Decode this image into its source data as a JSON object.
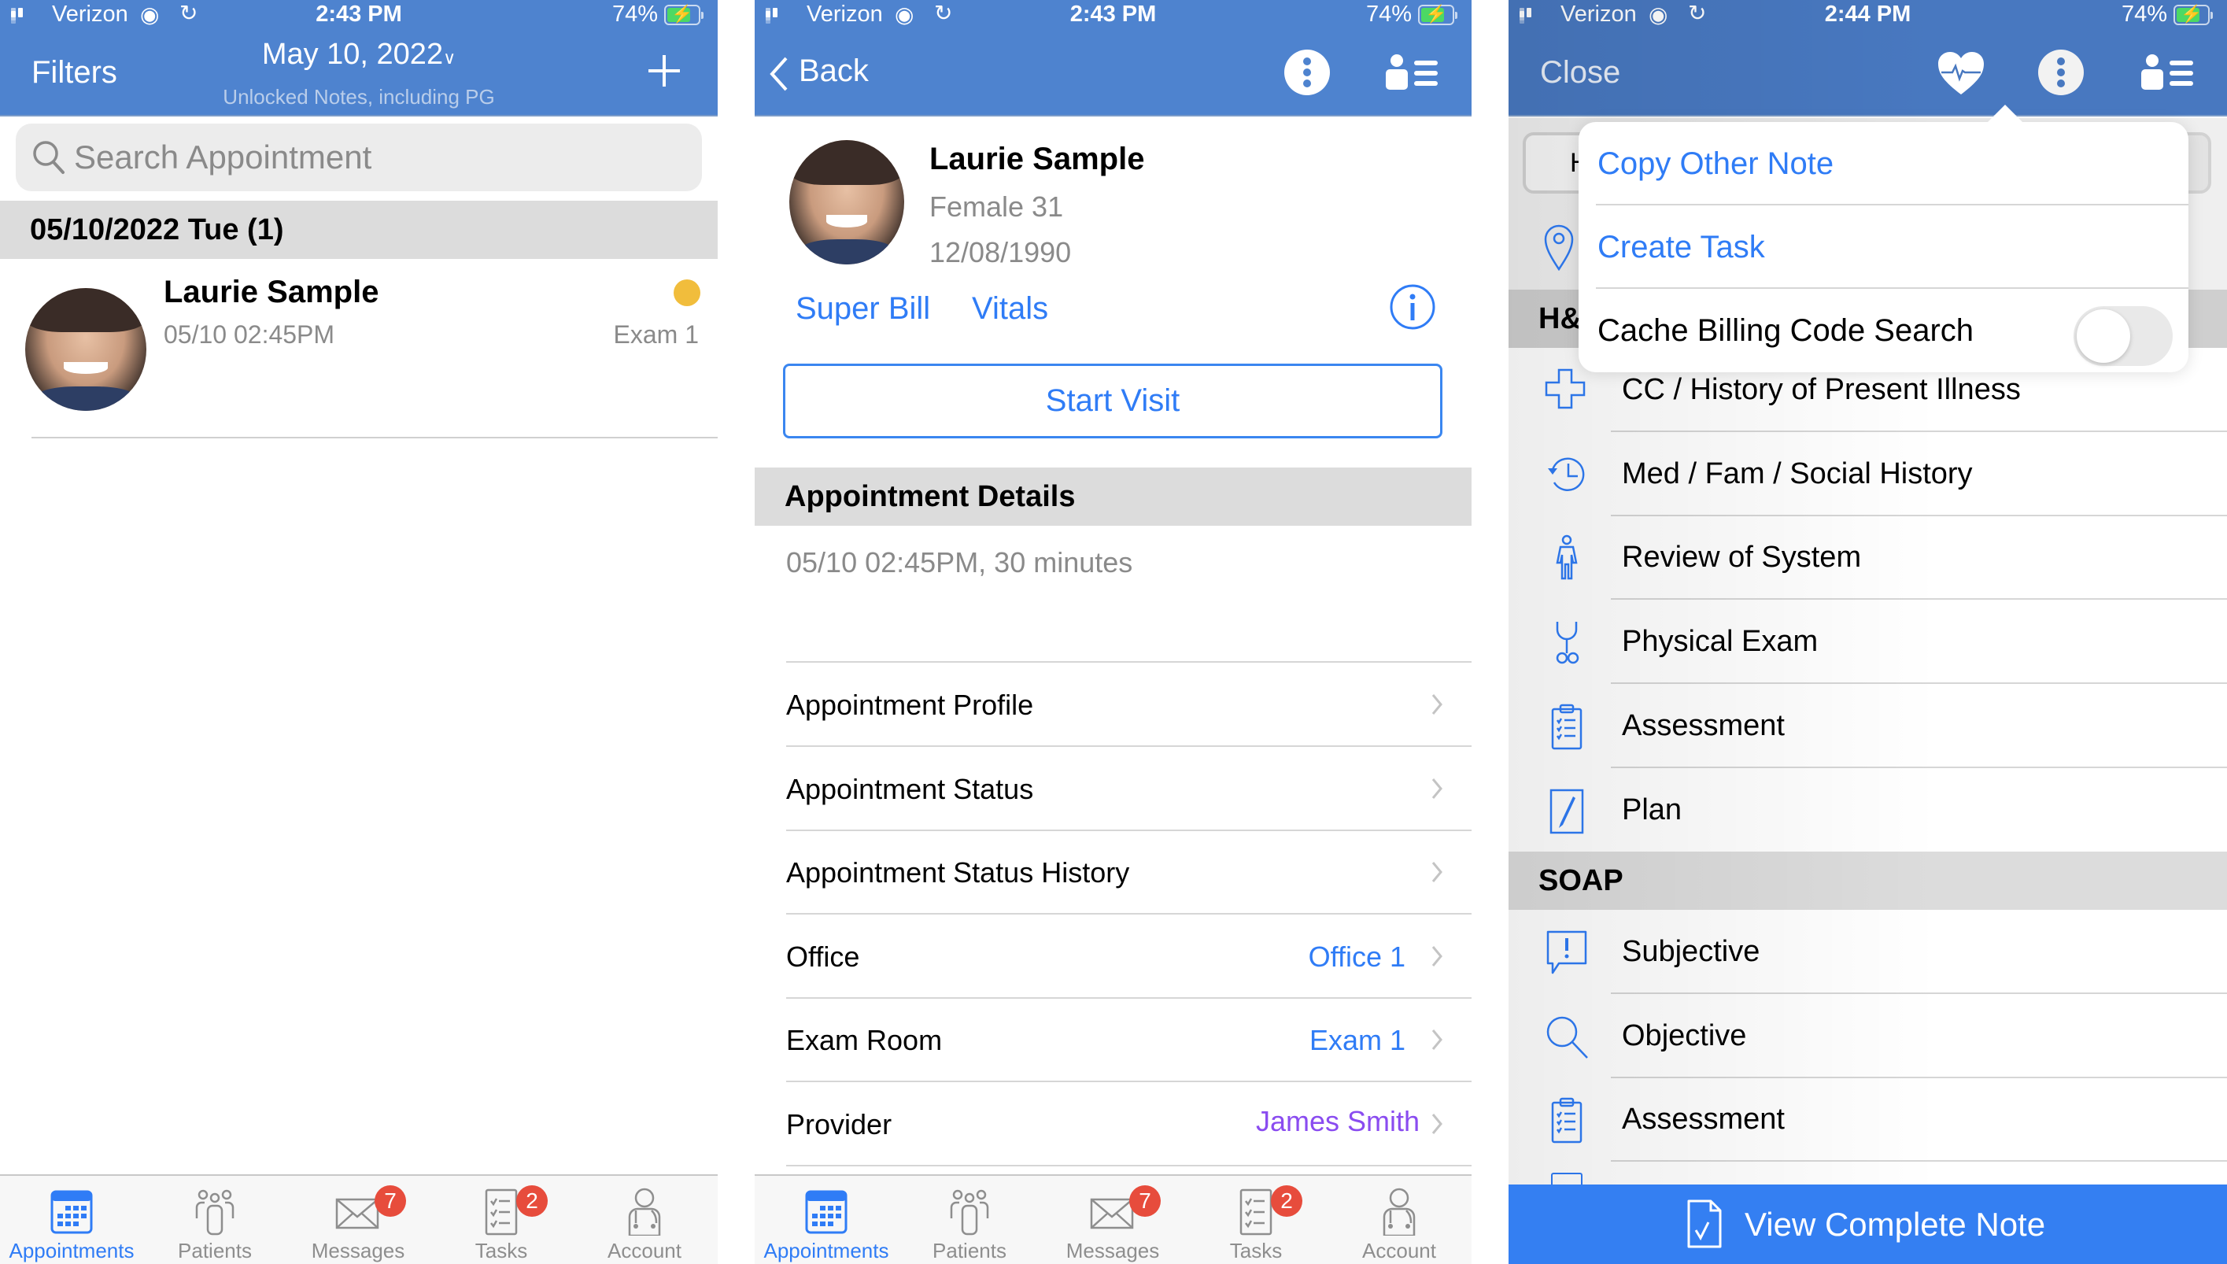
{
  "colors": {
    "header_blue": "#4e83cf",
    "accent_blue": "#2f7cf6",
    "provider_purple": "#8a4cf0",
    "status_dot": "#f1bd3c",
    "badge_red": "#e74c3c",
    "button_blue": "#347ff2"
  },
  "status_bars": [
    {
      "carrier": "Verizon",
      "time": "2:43 PM",
      "battery": "74%"
    },
    {
      "carrier": "Verizon",
      "time": "2:43 PM",
      "battery": "74%"
    },
    {
      "carrier": "Verizon",
      "time": "2:44 PM",
      "battery": "74%"
    }
  ],
  "screen1": {
    "header": {
      "left_label": "Filters",
      "title": "May 10, 2022",
      "title_chevron": "chevron-down-icon",
      "subtitle": "Unlocked Notes, including PG",
      "right_icon": "plus-icon"
    },
    "search": {
      "placeholder": "Search Appointment",
      "value": ""
    },
    "section_header": "05/10/2022 Tue (1)",
    "appointments": [
      {
        "name": "Laurie Sample",
        "time": "05/10 02:45PM",
        "room": "Exam 1",
        "status_dot": "yellow"
      }
    ]
  },
  "screen2": {
    "header": {
      "back_label": "Back",
      "icons": [
        "more-vertical-icon",
        "patient-list-icon"
      ]
    },
    "patient": {
      "name": "Laurie Sample",
      "gender_age": "Female 31",
      "dob": "12/08/1990"
    },
    "links": {
      "super_bill": "Super Bill",
      "vitals": "Vitals"
    },
    "start_visit_label": "Start Visit",
    "details_header": "Appointment Details",
    "details_summary": "05/10 02:45PM, 30 minutes",
    "detail_rows": [
      {
        "label": "Appointment Profile",
        "value": ""
      },
      {
        "label": "Appointment Status",
        "value": ""
      },
      {
        "label": "Appointment Status History",
        "value": ""
      },
      {
        "label": "Office",
        "value": "Office 1"
      },
      {
        "label": "Exam Room",
        "value": "Exam 1"
      },
      {
        "label": "Provider",
        "value": "James Smith"
      }
    ]
  },
  "screen3": {
    "header": {
      "close_label": "Close",
      "icons": [
        "heart-pulse-icon",
        "more-vertical-icon",
        "patient-list-icon"
      ]
    },
    "segment_first_letter": "H",
    "section_hp_partial": "H&",
    "popover": {
      "items": [
        {
          "label": "Copy Other Note"
        },
        {
          "label": "Create Task"
        },
        {
          "label": "Cache Billing Code Search",
          "toggle_on": false
        }
      ]
    },
    "hp_items": [
      {
        "label": "CC / History of Present Illness",
        "icon": "medical-cross-icon"
      },
      {
        "label": "Med / Fam / Social History",
        "icon": "history-clock-icon"
      },
      {
        "label": "Review of System",
        "icon": "person-body-icon"
      },
      {
        "label": "Physical Exam",
        "icon": "stethoscope-icon"
      },
      {
        "label": "Assessment",
        "icon": "clipboard-checklist-icon"
      },
      {
        "label": "Plan",
        "icon": "pen-document-icon"
      }
    ],
    "soap_header": "SOAP",
    "soap_items": [
      {
        "label": "Subjective",
        "icon": "speech-exclamation-icon"
      },
      {
        "label": "Objective",
        "icon": "magnifier-icon"
      },
      {
        "label": "Assessment",
        "icon": "clipboard-checklist-icon"
      }
    ],
    "view_note_label": "View Complete Note"
  },
  "tabbar": {
    "tabs": [
      {
        "label": "Appointments",
        "icon": "calendar-icon",
        "active": true,
        "badge": ""
      },
      {
        "label": "Patients",
        "icon": "patients-icon",
        "active": false,
        "badge": ""
      },
      {
        "label": "Messages",
        "icon": "envelope-icon",
        "active": false,
        "badge": "7"
      },
      {
        "label": "Tasks",
        "icon": "task-list-icon",
        "active": false,
        "badge": "2"
      },
      {
        "label": "Account",
        "icon": "doctor-account-icon",
        "active": false,
        "badge": ""
      }
    ]
  }
}
